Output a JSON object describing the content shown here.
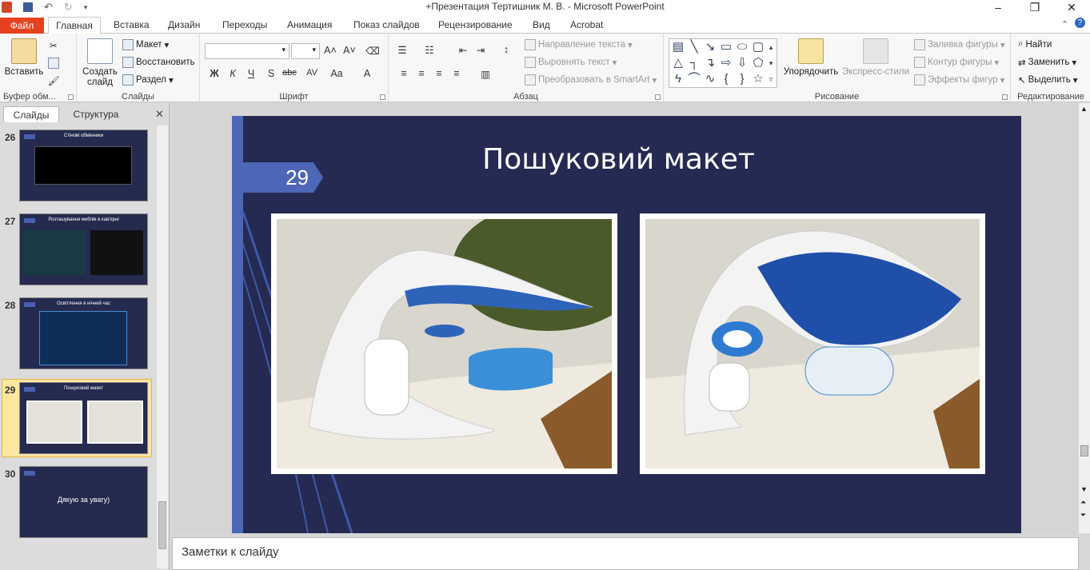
{
  "window": {
    "title": "+Презентация Тертишник  М. В.  -  Microsoft PowerPoint",
    "controls": {
      "minimize": "–",
      "restore": "❐",
      "close": "✕"
    }
  },
  "tabs": {
    "file": "Файл",
    "items": [
      "Главная",
      "Вставка",
      "Дизайн",
      "Переходы",
      "Анимация",
      "Показ слайдов",
      "Рецензирование",
      "Вид",
      "Acrobat"
    ],
    "active": "Главная"
  },
  "ribbon": {
    "clipboard": {
      "paste": "Вставить",
      "label": "Буфер обм..."
    },
    "slides": {
      "new_slide": "Создать слайд",
      "layout": "Макет",
      "reset": "Восстановить",
      "section": "Раздел",
      "label": "Слайды"
    },
    "font": {
      "bold": "Ж",
      "italic": "К",
      "underline": "Ч",
      "shadow": "S",
      "strike": "abc",
      "spacing": "AV",
      "case": "Aa",
      "color": "A",
      "label": "Шрифт"
    },
    "paragraph": {
      "text_direction": "Направление текста",
      "align_text": "Выровнять текст",
      "smartart": "Преобразовать в SmartArt",
      "label": "Абзац"
    },
    "drawing": {
      "arrange": "Упорядочить",
      "quick_styles": "Экспресс-стили",
      "fill": "Заливка фигуры",
      "outline": "Контур фигуры",
      "effects": "Эффекты фигур",
      "label": "Рисование"
    },
    "editing": {
      "find": "Найти",
      "replace": "Заменить",
      "select": "Выделить",
      "label": "Редактирование"
    }
  },
  "panel": {
    "tab_slides": "Слайды",
    "tab_outline": "Структура",
    "thumbs": [
      {
        "num": "26",
        "title": "Стінові обмінники"
      },
      {
        "num": "27",
        "title": "Розташування меблів в кав'ярні"
      },
      {
        "num": "28",
        "title": "Освітлення в нічний час"
      },
      {
        "num": "29",
        "title": "Пошуковий макет"
      },
      {
        "num": "30",
        "title": "Дякую за увагу)"
      }
    ],
    "selected": "29"
  },
  "slide": {
    "number": "29",
    "title": "Пошуковий макет"
  },
  "notes": {
    "placeholder": "Заметки к слайду"
  },
  "colors": {
    "accent": "#4d66b5",
    "slide_bg": "#252a52",
    "file_tab": "#e5411e",
    "selection": "#f3c44b"
  }
}
